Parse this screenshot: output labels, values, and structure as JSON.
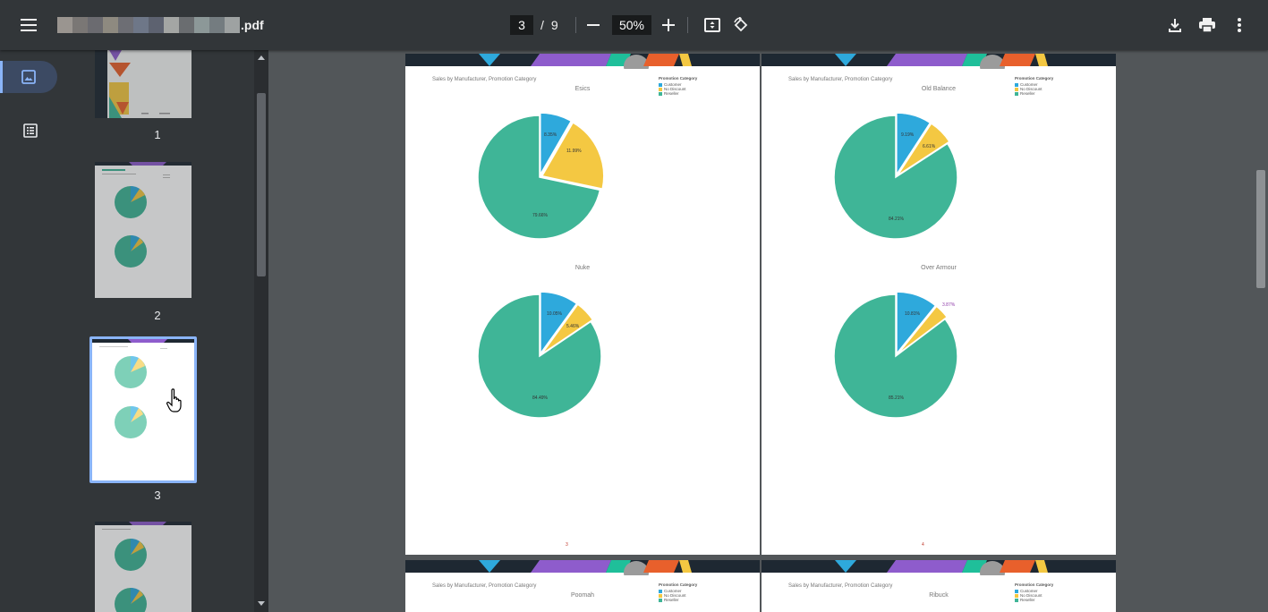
{
  "toolbar": {
    "filename_ext": ".pdf",
    "current_page": "3",
    "page_separator": "/",
    "total_pages": "9",
    "zoom": "50%"
  },
  "sidebar": {
    "thumbnails": [
      {
        "label": "1"
      },
      {
        "label": "2"
      },
      {
        "label": "3"
      }
    ]
  },
  "pages": [
    {
      "title": "Sales by Manufacturer, Promotion Category",
      "legend_title": "Promotion Category",
      "legend": [
        "Customer",
        "No Discount",
        "Reseller"
      ],
      "page_number": "3",
      "charts": [
        {
          "name": "Esics",
          "labels": [
            "8.35%",
            "11.99%",
            "79.66%"
          ]
        },
        {
          "name": "Nuke",
          "labels": [
            "10.05%",
            "5.46%",
            "84.49%"
          ]
        }
      ]
    },
    {
      "title": "Sales by Manufacturer, Promotion Category",
      "legend_title": "Promotion Category",
      "legend": [
        "Customer",
        "No Discount",
        "Reseller"
      ],
      "page_number": "4",
      "charts": [
        {
          "name": "Old Balance",
          "labels": [
            "9.19%",
            "6.61%",
            "84.21%"
          ]
        },
        {
          "name": "Over Armour",
          "labels": [
            "10.81%",
            "3.87%",
            "85.21%"
          ]
        }
      ]
    },
    {
      "title": "Sales by Manufacturer, Promotion Category",
      "legend_title": "Promotion Category",
      "legend": [
        "Customer",
        "No Discount",
        "Reseller"
      ],
      "charts": [
        {
          "name": "Poomah"
        }
      ]
    },
    {
      "title": "Sales by Manufacturer, Promotion Category",
      "legend_title": "Promotion Category",
      "legend": [
        "Customer",
        "No Discount",
        "Reseller"
      ],
      "charts": [
        {
          "name": "Ribuck"
        }
      ]
    }
  ],
  "colors": {
    "customer": "#2ea9dc",
    "no_discount": "#f4c842",
    "reseller": "#3fb597",
    "accent": "#8ab4f8",
    "toolbar": "#323639"
  },
  "icons": [
    "menu-icon",
    "thumbnail-view-icon",
    "outline-view-icon",
    "zoom-out-icon",
    "zoom-in-icon",
    "fit-page-icon",
    "rotate-icon",
    "download-icon",
    "print-icon",
    "more-vert-icon"
  ]
}
